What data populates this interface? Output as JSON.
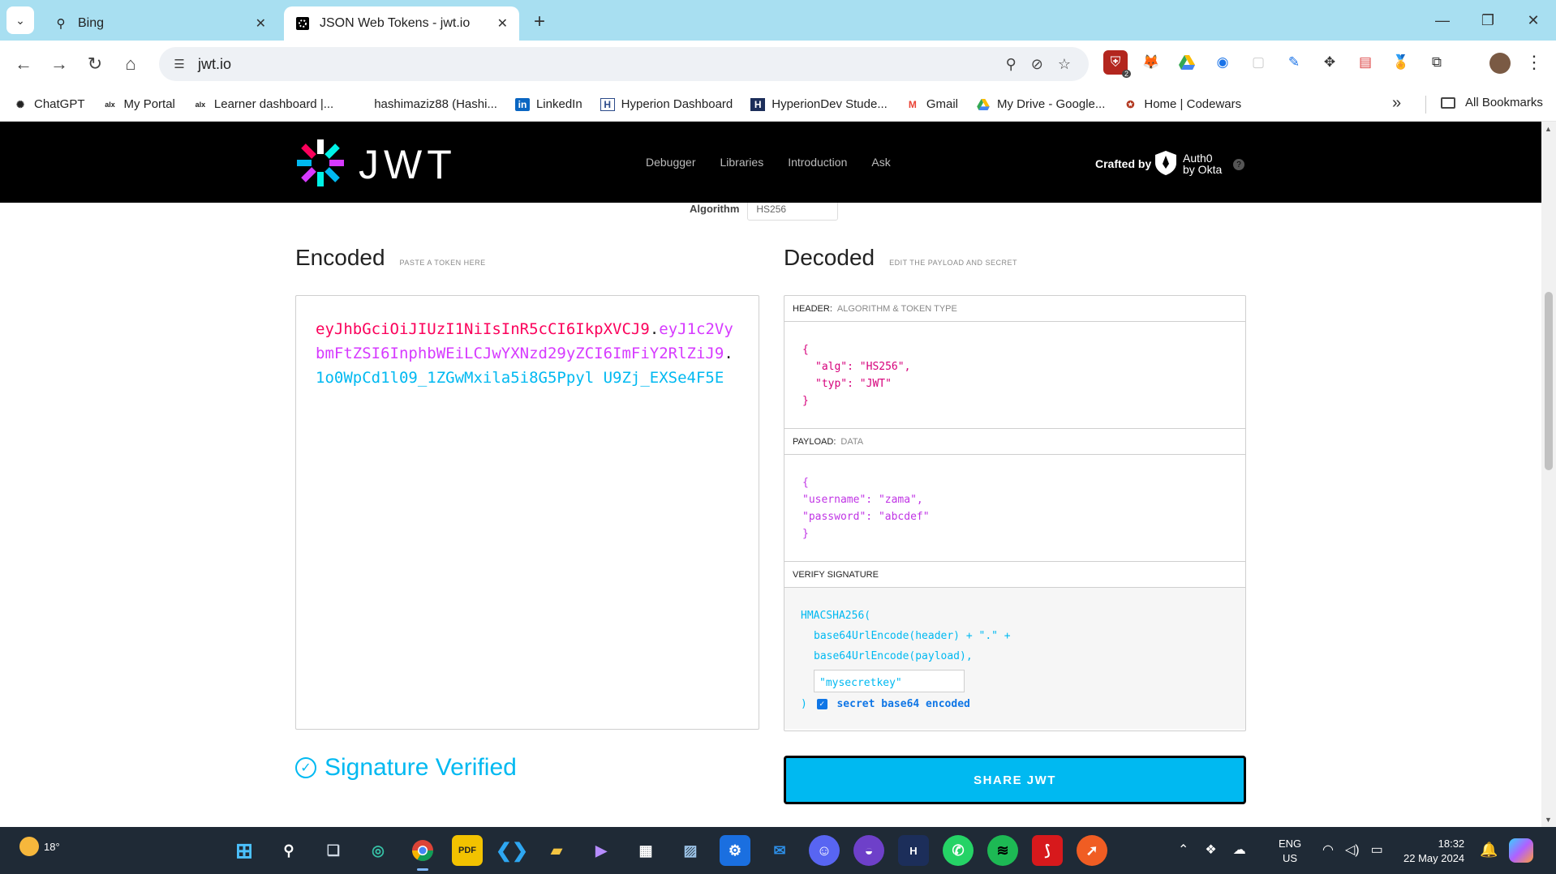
{
  "browser": {
    "tabs": [
      {
        "title": "Bing",
        "icon": "search-icon",
        "active": false
      },
      {
        "title": "JSON Web Tokens - jwt.io",
        "icon": "jwt-favicon",
        "active": true
      }
    ],
    "url": "jwt.io",
    "bookmarks": [
      {
        "label": "ChatGPT",
        "icon": "chatgpt-icon"
      },
      {
        "label": "My Portal",
        "icon": "alx-icon"
      },
      {
        "label": "Learner dashboard |...",
        "icon": "alx-icon"
      },
      {
        "label": "hashimaziz88 (Hashi...",
        "icon": "github-icon"
      },
      {
        "label": "LinkedIn",
        "icon": "linkedin-icon"
      },
      {
        "label": "Hyperion Dashboard",
        "icon": "hyperion-icon"
      },
      {
        "label": "HyperionDev Stude...",
        "icon": "hyperion-icon"
      },
      {
        "label": "Gmail",
        "icon": "gmail-icon"
      },
      {
        "label": "My Drive - Google...",
        "icon": "drive-icon"
      },
      {
        "label": "Home | Codewars",
        "icon": "codewars-icon"
      }
    ],
    "all_bookmarks": "All Bookmarks",
    "extension_badge": "2"
  },
  "site": {
    "logo_text": "JWT",
    "nav": [
      "Debugger",
      "Libraries",
      "Introduction",
      "Ask"
    ],
    "crafted_by": "Crafted by",
    "auth0_line1": "Auth0",
    "auth0_line2": "by Okta",
    "algorithm_label": "Algorithm",
    "algorithm_value": "HS256"
  },
  "encoded": {
    "title": "Encoded",
    "subtitle": "PASTE A TOKEN HERE",
    "header_part": "eyJhbGciOiJIUzI1NiIsInR5cCI6IkpXVCJ9",
    "payload_part": "eyJ1c2VybmFtZSI6InphbWEiLCJwYXNzd29yZCI6ImFiY2RlZiJ9",
    "signature_part": "1o0WpCd1l09_1ZGwMxila5i8G5Ppyl U9Zj_EXSe4F5E",
    "dot": "."
  },
  "decoded": {
    "title": "Decoded",
    "subtitle": "EDIT THE PAYLOAD AND SECRET",
    "header_label": "HEADER:",
    "header_sub": "ALGORITHM & TOKEN TYPE",
    "header_json": {
      "open": "{",
      "line1_key": "\"alg\"",
      "line1_val": "\"HS256\",",
      "line2_key": "\"typ\"",
      "line2_val": "\"JWT\"",
      "close": "}"
    },
    "payload_label": "PAYLOAD:",
    "payload_sub": "DATA",
    "payload_json": {
      "open": "{",
      "line1_key": "\"username\"",
      "line1_val": "\"zama\",",
      "line2_key": "\"password\"",
      "line2_val": "\"abcdef\"",
      "close": "}"
    },
    "verify_label": "VERIFY SIGNATURE",
    "verify": {
      "fn": "HMACSHA256(",
      "line1": "base64UrlEncode(header) + \".\" +",
      "line2": "base64UrlEncode(payload),",
      "secret": "\"mysecretkey\"",
      "close": ")",
      "checkbox_label": "secret base64 encoded",
      "checkbox_checked": true
    }
  },
  "status": {
    "verified_text": "Signature Verified",
    "share_button": "SHARE JWT"
  },
  "taskbar": {
    "temperature": "18°",
    "language_line1": "ENG",
    "language_line2": "US",
    "time": "18:32",
    "date": "22 May 2024"
  },
  "colors": {
    "token_header": "#fb015b",
    "token_payload": "#d63aff",
    "token_signature": "#00b9f1",
    "accent": "#00b9f1"
  }
}
